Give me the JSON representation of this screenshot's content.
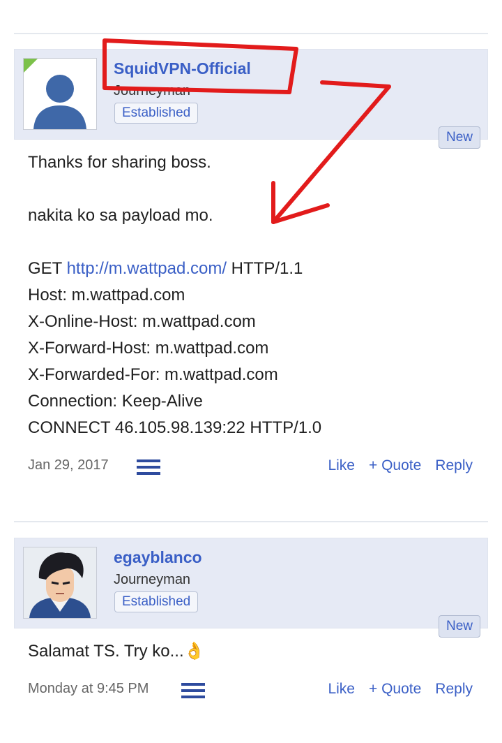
{
  "posts": [
    {
      "username": "SquidVPN-Official",
      "user_title": "Journeyman",
      "badge": "Established",
      "new_tag": "New",
      "avatar": "default-avatar-icon",
      "lines": [
        "Thanks for sharing boss.",
        "",
        "nakita ko sa payload mo.",
        "",
        "GET",
        "Host: m.wattpad.com",
        "X-Online-Host: m.wattpad.com",
        "X-Forward-Host: m.wattpad.com",
        "X-Forwarded-For: m.wattpad.com",
        "Connection: Keep-Alive",
        "CONNECT 46.105.98.139:22 HTTP/1.0"
      ],
      "get_link": "http://m.wattpad.com/",
      "get_suffix": " HTTP/1.1",
      "date": "Jan 29, 2017",
      "like": "Like",
      "quote": "+ Quote",
      "reply": "Reply"
    },
    {
      "username": "egayblanco",
      "user_title": "Journeyman",
      "badge": "Established",
      "new_tag": "New",
      "avatar": "anime-avatar-icon",
      "message": "Salamat TS. Try ko...👌",
      "date": "Monday at 9:45 PM",
      "like": "Like",
      "quote": "+ Quote",
      "reply": "Reply"
    }
  ],
  "colors": {
    "accent": "#3a5fc6",
    "header_bg": "#e6eaf5",
    "annotation": "#e21b1b"
  }
}
